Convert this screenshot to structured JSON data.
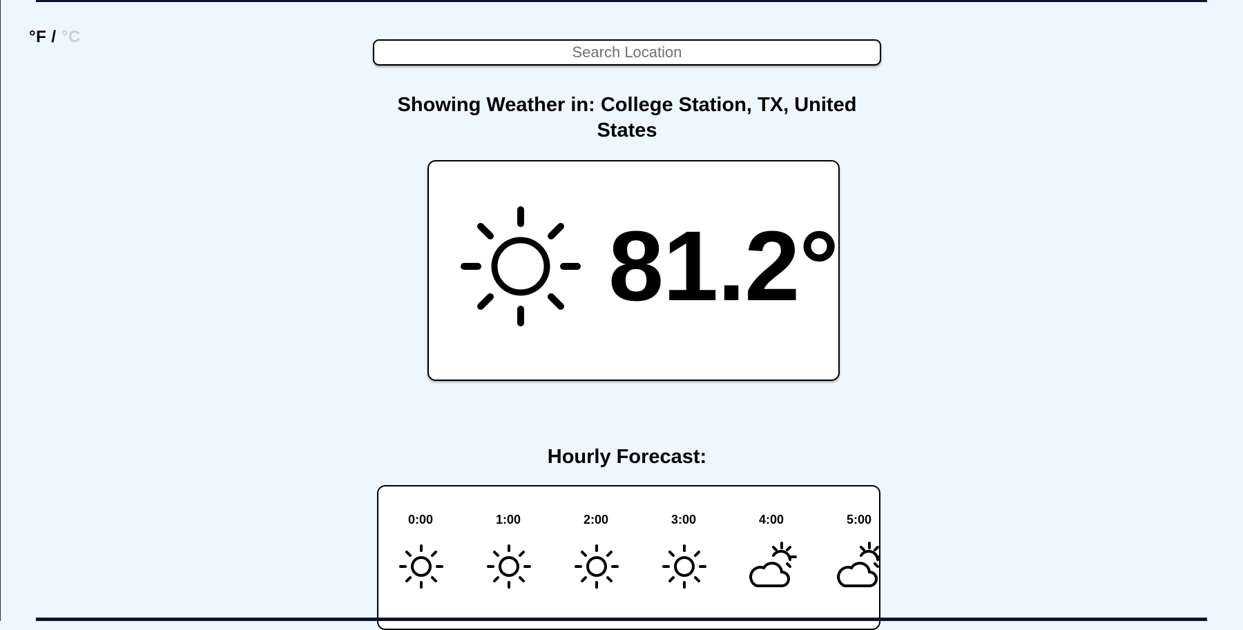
{
  "units": {
    "fahrenheit_label": "°F",
    "separator": " / ",
    "celsius_label": "°C",
    "selected": "fahrenheit"
  },
  "search": {
    "placeholder": "Search Location",
    "value": ""
  },
  "location": {
    "heading": "Showing Weather in: College Station, TX, United States"
  },
  "current": {
    "icon": "sun-icon",
    "temperature": "81.2°"
  },
  "hourly": {
    "heading": "Hourly Forecast:",
    "items": [
      {
        "time": "0:00",
        "icon": "sun-icon"
      },
      {
        "time": "1:00",
        "icon": "sun-icon"
      },
      {
        "time": "2:00",
        "icon": "sun-icon"
      },
      {
        "time": "3:00",
        "icon": "sun-icon"
      },
      {
        "time": "4:00",
        "icon": "partly-cloudy-icon"
      },
      {
        "time": "5:00",
        "icon": "partly-cloudy-icon"
      }
    ]
  },
  "colors": {
    "background": "#eef6fe",
    "frame": "#0d1230",
    "inactive_unit": "#cfcfcf"
  }
}
